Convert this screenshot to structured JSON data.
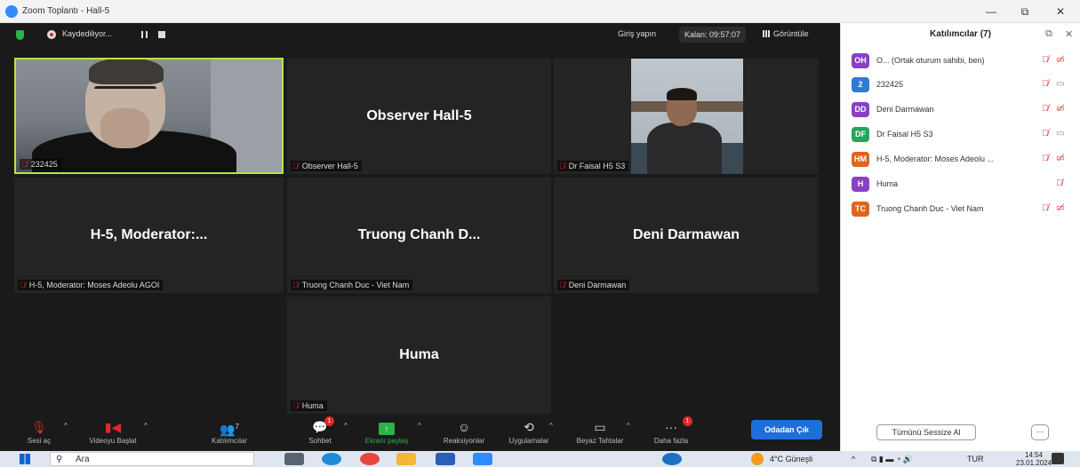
{
  "window": {
    "title": "Zoom Toplantı - Hall-5",
    "min": "—",
    "max": "⧉",
    "close": "✕"
  },
  "topbar": {
    "recording_label": "Kaydediliyor...",
    "signin_label": "Giriş yapın",
    "remaining_label": "Kalan: 09:57:07",
    "view_label": "Görüntüle"
  },
  "tiles": [
    {
      "center_name": "",
      "tag": "232425"
    },
    {
      "center_name": "Observer Hall-5",
      "tag": "Observer Hall-5"
    },
    {
      "center_name": "",
      "tag": "Dr Faisal H5 S3"
    },
    {
      "center_name": "H-5, Moderator:...",
      "tag": "H-5, Moderator: Moses Adeolu AGOI"
    },
    {
      "center_name": "Truong Chanh D...",
      "tag": "Truong Chanh Duc - Viet Nam"
    },
    {
      "center_name": "Deni Darmawan",
      "tag": "Deni Darmawan"
    },
    {
      "center_name": "Huma",
      "tag": "Huma"
    }
  ],
  "toolbar": {
    "audio": "Sesi aç",
    "video": "Videoyu Başlat",
    "participants": "Katılımcılar",
    "participants_count": "7",
    "chat": "Sohbet",
    "chat_badge": "1",
    "share": "Ekranı paylaş",
    "reactions": "Reaksiyonlar",
    "apps": "Uygulamalar",
    "whiteboards": "Beyaz Tahtalar",
    "more": "Daha fazla",
    "more_badge": "1",
    "leave": "Odadan Çık"
  },
  "panel": {
    "title": "Katılımcılar (7)",
    "participants": [
      {
        "initials": "OH",
        "color": "#8a3fc4",
        "name": "O... (Ortak oturum sahibi, ben)",
        "camera": "off"
      },
      {
        "initials": "2",
        "color": "#2e7bd6",
        "name": "232425",
        "camera": "on"
      },
      {
        "initials": "DD",
        "color": "#8a3fc4",
        "name": "Deni Darmawan",
        "camera": "off"
      },
      {
        "initials": "DF",
        "color": "#23a55a",
        "name": "Dr Faisal H5 S3",
        "camera": "on"
      },
      {
        "initials": "HM",
        "color": "#e0651e",
        "name": "H-5, Moderator: Moses Adeolu ...",
        "camera": "off"
      },
      {
        "initials": "H",
        "color": "#8a3fc4",
        "name": "Huma",
        "camera": "none"
      },
      {
        "initials": "TC",
        "color": "#e0651e",
        "name": "Truong Chanh Duc - Viet Nam",
        "camera": "off"
      }
    ],
    "mute_all": "Tümünü Sessize Al",
    "more": "···"
  },
  "taskbar": {
    "search_placeholder": "Ara",
    "weather": "4°C Güneşli",
    "lang": "TUR",
    "time": "14:54",
    "date": "23.01.2024"
  },
  "colors": {
    "accent": "#1e6fd9",
    "active_speaker": "#b6e34a",
    "muted_red": "#e02828"
  }
}
